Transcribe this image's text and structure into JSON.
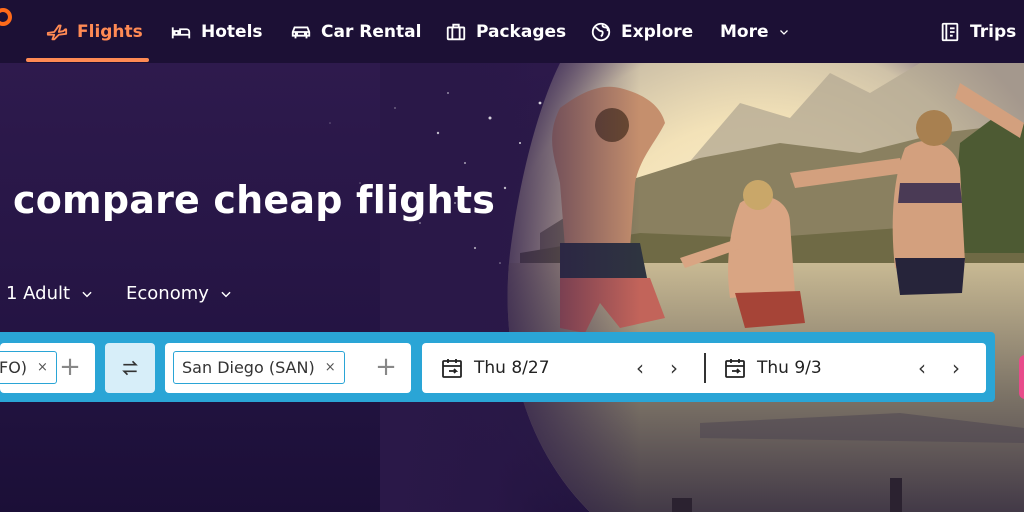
{
  "nav": {
    "items": [
      {
        "label": "Flights",
        "icon": "plane-icon"
      },
      {
        "label": "Hotels",
        "icon": "bed-icon"
      },
      {
        "label": "Car Rental",
        "icon": "car-icon"
      },
      {
        "label": "Packages",
        "icon": "suitcase-icon"
      },
      {
        "label": "Explore",
        "icon": "globe-icon"
      },
      {
        "label": "More",
        "icon": "chevron-down-icon"
      },
      {
        "label": "Trips",
        "icon": "trips-icon"
      }
    ],
    "active_color": "#ff8a54"
  },
  "hero": {
    "headline": "compare cheap flights",
    "travelers": "1 Adult",
    "cabin": "Economy"
  },
  "search": {
    "origin_chip": "FO)",
    "destination_chip": "San Diego (SAN)",
    "depart_date": "Thu 8/27",
    "return_date": "Thu 9/3",
    "remove_glyph": "×",
    "plus_glyph": "+",
    "prev_glyph": "‹",
    "next_glyph": "›",
    "accent": "#2aa5d6"
  }
}
